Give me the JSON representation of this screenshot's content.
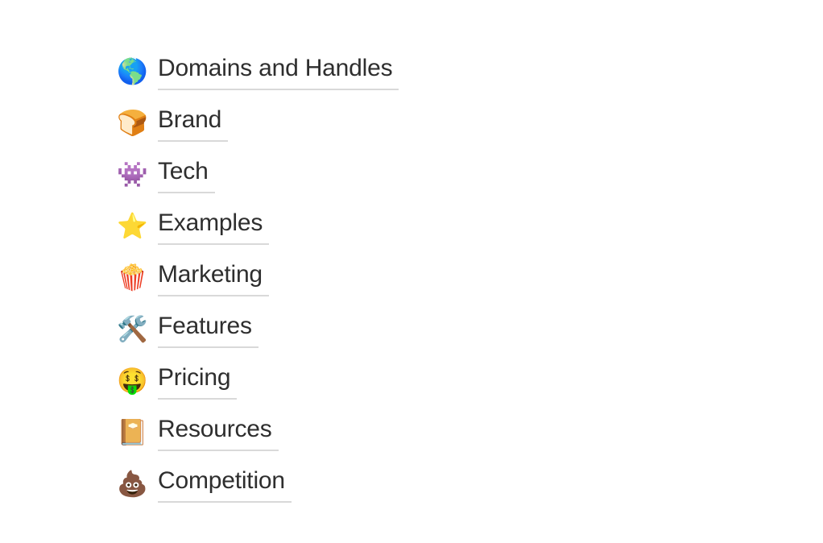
{
  "page": {
    "background_color": "#ffffff",
    "text_color": "#2e2e2e",
    "underline_color": "#d9d9d9"
  },
  "nav": {
    "items": [
      {
        "emoji": "🌎",
        "icon_name": "globe-americas-icon",
        "label": "Domains and Handles"
      },
      {
        "emoji": "🍞",
        "icon_name": "bread-icon",
        "label": "Brand"
      },
      {
        "emoji": "👾",
        "icon_name": "alien-monster-icon",
        "label": "Tech"
      },
      {
        "emoji": "⭐",
        "icon_name": "star-icon",
        "label": "Examples"
      },
      {
        "emoji": "🍿",
        "icon_name": "popcorn-icon",
        "label": "Marketing"
      },
      {
        "emoji": "🛠️",
        "icon_name": "hammer-and-wrench-icon",
        "label": "Features"
      },
      {
        "emoji": "🤑",
        "icon_name": "money-mouth-face-icon",
        "label": "Pricing"
      },
      {
        "emoji": "📔",
        "icon_name": "notebook-with-decorative-cover-icon",
        "label": "Resources"
      },
      {
        "emoji": "💩",
        "icon_name": "pile-of-poo-icon",
        "label": "Competition"
      }
    ]
  }
}
